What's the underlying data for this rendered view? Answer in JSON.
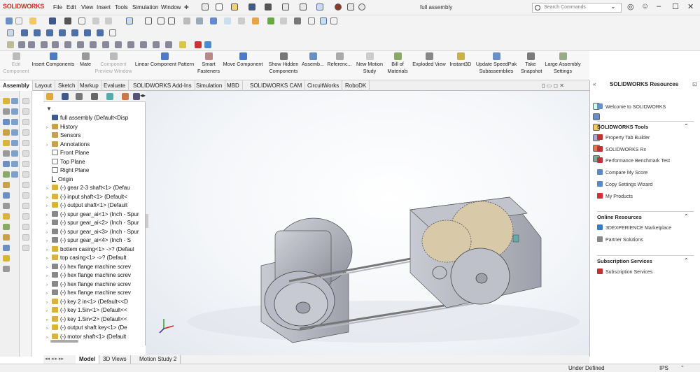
{
  "app": {
    "logo_text": "SOLIDWORKS",
    "document_title": "full assembly"
  },
  "menu": [
    "File",
    "Edit",
    "View",
    "Insert",
    "Tools",
    "Simulation",
    "Window"
  ],
  "search": {
    "placeholder": "Search Commands"
  },
  "command_manager": [
    {
      "label": "Edit\nComponent",
      "disabled": true
    },
    {
      "label": "Insert Components",
      "disabled": false
    },
    {
      "label": "Mate",
      "disabled": false
    },
    {
      "label": "Component\nPreview Window",
      "disabled": true
    },
    {
      "label": "Linear Component Pattern",
      "disabled": false
    },
    {
      "label": "Smart\nFasteners",
      "disabled": false
    },
    {
      "label": "Move Component",
      "disabled": false
    },
    {
      "label": "Show Hidden\nComponents",
      "disabled": false
    },
    {
      "label": "Assemb...",
      "disabled": false
    },
    {
      "label": "Referenc...",
      "disabled": false
    },
    {
      "label": "New Motion\nStudy",
      "disabled": false
    },
    {
      "label": "Bill of\nMaterials",
      "disabled": false
    },
    {
      "label": "Exploded View",
      "disabled": false
    },
    {
      "label": "Instant3D",
      "disabled": false
    },
    {
      "label": "Update SpeedPak\nSubassemblies",
      "disabled": false
    },
    {
      "label": "Take\nSnapshot",
      "disabled": false
    },
    {
      "label": "Large Assembly\nSettings",
      "disabled": false
    }
  ],
  "tabs": [
    "Assembly",
    "Layout",
    "Sketch",
    "Markup",
    "Evaluate",
    "SOLIDWORKS Add-Ins",
    "Simulation",
    "MBD",
    "SOLIDWORKS CAM",
    "CircuitWorks",
    "RoboDK"
  ],
  "active_tab": "Assembly",
  "feature_tree": [
    {
      "text": "full assembly  (Default<Disp",
      "icon": "assembly",
      "arrow": ""
    },
    {
      "text": "History",
      "icon": "folder",
      "arrow": "›"
    },
    {
      "text": "Sensors",
      "icon": "folder",
      "arrow": ""
    },
    {
      "text": "Annotations",
      "icon": "folder",
      "arrow": "›"
    },
    {
      "text": "Front Plane",
      "icon": "plane",
      "arrow": ""
    },
    {
      "text": "Top Plane",
      "icon": "plane",
      "arrow": ""
    },
    {
      "text": "Right Plane",
      "icon": "plane",
      "arrow": ""
    },
    {
      "text": "Origin",
      "icon": "origin",
      "arrow": ""
    },
    {
      "text": "(-) gear 2-3 shaft<1> (Defau",
      "icon": "part",
      "arrow": "›"
    },
    {
      "text": "(-) input shaft<1> (Default<",
      "icon": "part",
      "arrow": "›"
    },
    {
      "text": "(-) output shaft<1> (Default",
      "icon": "part",
      "arrow": "›"
    },
    {
      "text": "(-) spur gear_ai<1> (Inch - Spur",
      "icon": "gear",
      "arrow": "›"
    },
    {
      "text": "(-) spur gear_ai<2> (Inch - Spur",
      "icon": "gear",
      "arrow": "›"
    },
    {
      "text": "(-) spur gear_ai<3> (Inch - Spur",
      "icon": "gear",
      "arrow": "›"
    },
    {
      "text": "(-) spur gear_ai<4> (Inch - S",
      "icon": "gear",
      "arrow": "›"
    },
    {
      "text": "bottem casing<1> ->? (Defaul",
      "icon": "part",
      "arrow": "›"
    },
    {
      "text": "top casing<1> ->? (Default",
      "icon": "part",
      "arrow": "›"
    },
    {
      "text": "(-) hex flange machine screv",
      "icon": "gear",
      "arrow": "›"
    },
    {
      "text": "(-) hex flange machine screv",
      "icon": "gear",
      "arrow": "›"
    },
    {
      "text": "(-) hex flange machine screv",
      "icon": "gear",
      "arrow": "›"
    },
    {
      "text": "(-) hex flange machine screv",
      "icon": "gear",
      "arrow": "›"
    },
    {
      "text": "(-) key 2 in<1> (Default<<D",
      "icon": "part",
      "arrow": "›"
    },
    {
      "text": "(-) key 1.5in<1> (Default<<",
      "icon": "part",
      "arrow": "›"
    },
    {
      "text": "(-) key 1.5in<2> (Default<<",
      "icon": "part",
      "arrow": "›"
    },
    {
      "text": "(-) output shaft key<1> (De",
      "icon": "part",
      "arrow": "›"
    },
    {
      "text": "(-) motor shaft<1> (Default",
      "icon": "part",
      "arrow": "›"
    }
  ],
  "resources": {
    "title": "SOLIDWORKS Resources",
    "welcome": "Welcome to SOLIDWORKS",
    "sections": [
      {
        "title": "SOLIDWORKS Tools",
        "items": [
          "Property Tab Builder",
          "SOLIDWORKS Rx",
          "Performance Benchmark Test",
          "Compare My Score",
          "Copy Settings Wizard",
          "My Products"
        ]
      },
      {
        "title": "Online Resources",
        "items": [
          "3DEXPERIENCE Marketplace",
          "Partner Solutions"
        ]
      },
      {
        "title": "Subscription Services",
        "items": [
          "Subscription Services"
        ]
      }
    ]
  },
  "bottom_tabs": [
    "Model",
    "3D Views",
    "Motion Study 2"
  ],
  "active_bottom_tab": "Model",
  "status": {
    "state": "Under Defined",
    "units": "IPS"
  },
  "colors": {
    "accent_red": "#d52b1e",
    "part_gold": "#d9b33a",
    "model_gray": "#b8bac4"
  }
}
